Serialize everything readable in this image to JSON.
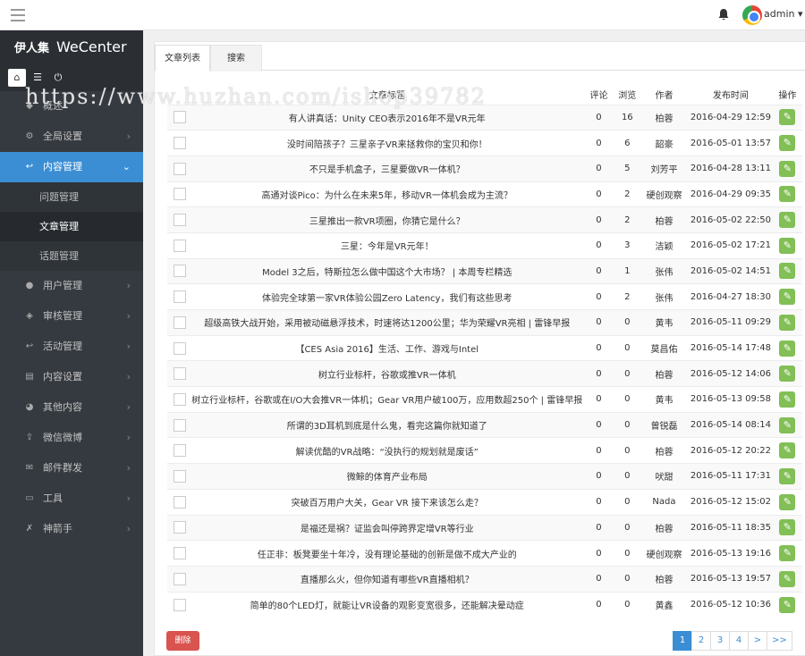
{
  "header": {
    "user_name": "admin",
    "icons": [
      "menu-icon",
      "bell-icon",
      "avatar-icon",
      "caret-down-icon"
    ]
  },
  "sidebar": {
    "brand_cn": "伊人集",
    "brand_en": "WeCenter",
    "quick_icons": [
      "home-icon",
      "list-icon",
      "power-icon"
    ],
    "items": [
      {
        "label": "概述",
        "icon": "dashboard-icon"
      },
      {
        "label": "全局设置",
        "icon": "gear-icon"
      },
      {
        "label": "内容管理",
        "icon": "reply-icon"
      },
      {
        "label": "用户管理",
        "icon": "user-icon"
      },
      {
        "label": "审核管理",
        "icon": "shield-icon"
      },
      {
        "label": "活动管理",
        "icon": "reply-icon"
      },
      {
        "label": "内容设置",
        "icon": "document-icon"
      },
      {
        "label": "其他内容",
        "icon": "pie-chart-icon"
      },
      {
        "label": "微信微博",
        "icon": "share-icon"
      },
      {
        "label": "邮件群发",
        "icon": "mail-icon"
      },
      {
        "label": "工具",
        "icon": "toolbox-icon"
      },
      {
        "label": "神箭手",
        "icon": "arrow-icon"
      }
    ],
    "submenu": [
      {
        "label": "问题管理"
      },
      {
        "label": "文章管理"
      },
      {
        "label": "话题管理"
      }
    ]
  },
  "tabs": [
    "文章列表",
    "搜索"
  ],
  "table": {
    "headers": {
      "title": "文章标题",
      "comments": "评论",
      "views": "浏览",
      "author": "作者",
      "time": "发布时间",
      "op": "操作"
    },
    "rows": [
      {
        "title": "有人讲真话：Unity CEO表示2016年不是VR元年",
        "comments": "0",
        "views": "16",
        "author": "柏蓉",
        "time": "2016-04-29 12:59"
      },
      {
        "title": "没时间陪孩子？三星亲子VR来拯救你的宝贝和你！",
        "comments": "0",
        "views": "6",
        "author": "韶豪",
        "time": "2016-05-01 13:57"
      },
      {
        "title": "不只是手机盒子，三星要做VR一体机？",
        "comments": "0",
        "views": "5",
        "author": "刘芳平",
        "time": "2016-04-28 13:11"
      },
      {
        "title": "高通对谈Pico：为什么在未来5年，移动VR一体机会成为主流？",
        "comments": "0",
        "views": "2",
        "author": "硬创观察",
        "time": "2016-04-29 09:35"
      },
      {
        "title": "三星推出一款VR项圈，你猜它是什么？",
        "comments": "0",
        "views": "2",
        "author": "柏蓉",
        "time": "2016-05-02 22:50"
      },
      {
        "title": "三星：今年是VR元年！",
        "comments": "0",
        "views": "3",
        "author": "洁颖",
        "time": "2016-05-02 17:21"
      },
      {
        "title": "Model 3之后，特斯拉怎么做中国这个大市场？ | 本周专栏精选",
        "comments": "0",
        "views": "1",
        "author": "张伟",
        "time": "2016-05-02 14:51"
      },
      {
        "title": "体验完全球第一家VR体验公园Zero Latency，我们有这些思考",
        "comments": "0",
        "views": "2",
        "author": "张伟",
        "time": "2016-04-27 18:30"
      },
      {
        "title": "超级高铁大战开始，采用被动磁悬浮技术，时速将达1200公里；华为荣耀VR亮相 | 雷锋早报",
        "comments": "0",
        "views": "0",
        "author": "黄韦",
        "time": "2016-05-11 09:29"
      },
      {
        "title": "【CES Asia 2016】生活、工作、游戏与Intel",
        "comments": "0",
        "views": "0",
        "author": "莫昌佑",
        "time": "2016-05-14 17:48"
      },
      {
        "title": "树立行业标杆，谷歌或推VR一体机",
        "comments": "0",
        "views": "0",
        "author": "柏蓉",
        "time": "2016-05-12 14:06"
      },
      {
        "title": "树立行业标杆，谷歌或在I/O大会推VR一体机；Gear VR用户破100万，应用数超250个 | 雷锋早报",
        "comments": "0",
        "views": "0",
        "author": "黄韦",
        "time": "2016-05-13 09:58"
      },
      {
        "title": "所谓的3D耳机到底是什么鬼，看完这篇你就知道了",
        "comments": "0",
        "views": "0",
        "author": "曾锐磊",
        "time": "2016-05-14 08:14"
      },
      {
        "title": "解读优酷的VR战略：“没执行的规划就是废话”",
        "comments": "0",
        "views": "0",
        "author": "柏蓉",
        "time": "2016-05-12 20:22"
      },
      {
        "title": "微鲸的体育产业布局",
        "comments": "0",
        "views": "0",
        "author": "吠甜",
        "time": "2016-05-11 17:31"
      },
      {
        "title": "突破百万用户大关，Gear VR 接下来该怎么走？",
        "comments": "0",
        "views": "0",
        "author": "Nada",
        "time": "2016-05-12 15:02"
      },
      {
        "title": "是福还是祸？证监会叫停跨界定增VR等行业",
        "comments": "0",
        "views": "0",
        "author": "柏蓉",
        "time": "2016-05-11 18:35"
      },
      {
        "title": "任正非：板凳要坐十年冷，没有理论基础的创新是做不成大产业的",
        "comments": "0",
        "views": "0",
        "author": "硬创观察",
        "time": "2016-05-13 19:16"
      },
      {
        "title": "直播那么火，但你知道有哪些VR直播相机？",
        "comments": "0",
        "views": "0",
        "author": "柏蓉",
        "time": "2016-05-13 19:57"
      },
      {
        "title": "简单的80个LED灯，就能让VR设备的观影变宽很多，还能解决晕动症",
        "comments": "0",
        "views": "0",
        "author": "黄鑫",
        "time": "2016-05-12 10:36"
      }
    ]
  },
  "footer": {
    "delete_label": "删除",
    "pages": [
      "1",
      "2",
      "3",
      "4",
      ">",
      ">>"
    ],
    "current_page": "1"
  },
  "watermark": "https://www.huzhan.com/ishop39782",
  "colors": {
    "accent": "#3b8ed3",
    "sidebar_bg": "#353a40",
    "edit_green": "#82bf56",
    "delete_red": "#d9534f"
  }
}
